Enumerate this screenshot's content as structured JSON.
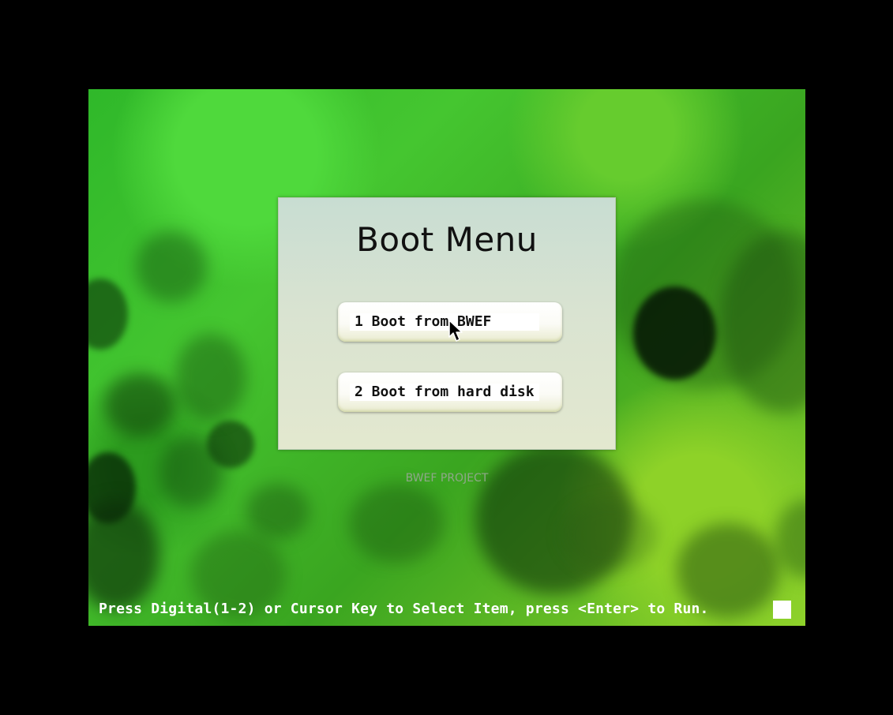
{
  "boot_menu": {
    "title": "Boot Menu",
    "items": [
      {
        "label": "1 Boot from BWEF"
      },
      {
        "label": "2 Boot from hard disk"
      }
    ]
  },
  "footer": {
    "project": "BWEF PROJECT",
    "status": "Press Digital(1-2) or Cursor Key to Select Item, press <Enter> to Run."
  },
  "icons": {
    "pointer": "mouse-pointer-icon"
  },
  "colors": {
    "background": "#000000",
    "accent_green": "#3fc22c",
    "panel": "#d6e2d1",
    "text": "#111111",
    "status_text": "#ffffff"
  }
}
